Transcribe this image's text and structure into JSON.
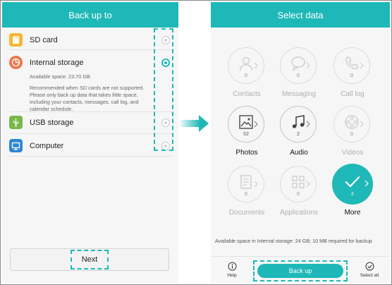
{
  "left": {
    "title": "Back up to",
    "options": [
      {
        "label": "SD card",
        "icon": "sd-card-icon",
        "color": "#f7b731"
      },
      {
        "label": "Internal storage",
        "icon": "pie-chart-icon",
        "color": "#f0744a",
        "space": "Available space: 23.70 GB",
        "note": "Recommended when SD cards are not supported. Please only back up data that takes little space, including your contacts, messages, call log, and calendar schedule."
      },
      {
        "label": "USB storage",
        "icon": "usb-icon",
        "color": "#7ab648"
      },
      {
        "label": "Computer",
        "icon": "computer-icon",
        "color": "#2f86d6"
      }
    ],
    "next_label": "Next"
  },
  "right": {
    "title": "Select data",
    "categories": [
      {
        "label": "Contacts",
        "count": "0",
        "icon": "person-icon"
      },
      {
        "label": "Messaging",
        "count": "0",
        "icon": "chat-bubble-icon"
      },
      {
        "label": "Call log",
        "count": "0",
        "icon": "phone-icon"
      },
      {
        "label": "Photos",
        "count": "52",
        "icon": "picture-icon"
      },
      {
        "label": "Audio",
        "count": "2",
        "icon": "music-note-icon"
      },
      {
        "label": "Videos",
        "count": "0",
        "icon": "film-reel-icon"
      },
      {
        "label": "Documents",
        "count": "0",
        "icon": "document-icon"
      },
      {
        "label": "Applications",
        "count": "0",
        "icon": "apps-grid-icon"
      },
      {
        "label": "More",
        "count": "2",
        "icon": "checkmark-icon"
      }
    ],
    "space_note": "Available space in Internal storage: 24 GB; 10 MB required for backup",
    "help_label": "Help",
    "backup_label": "Back up",
    "select_all_label": "Select all"
  },
  "colors": {
    "accent": "#1fb8b8"
  }
}
